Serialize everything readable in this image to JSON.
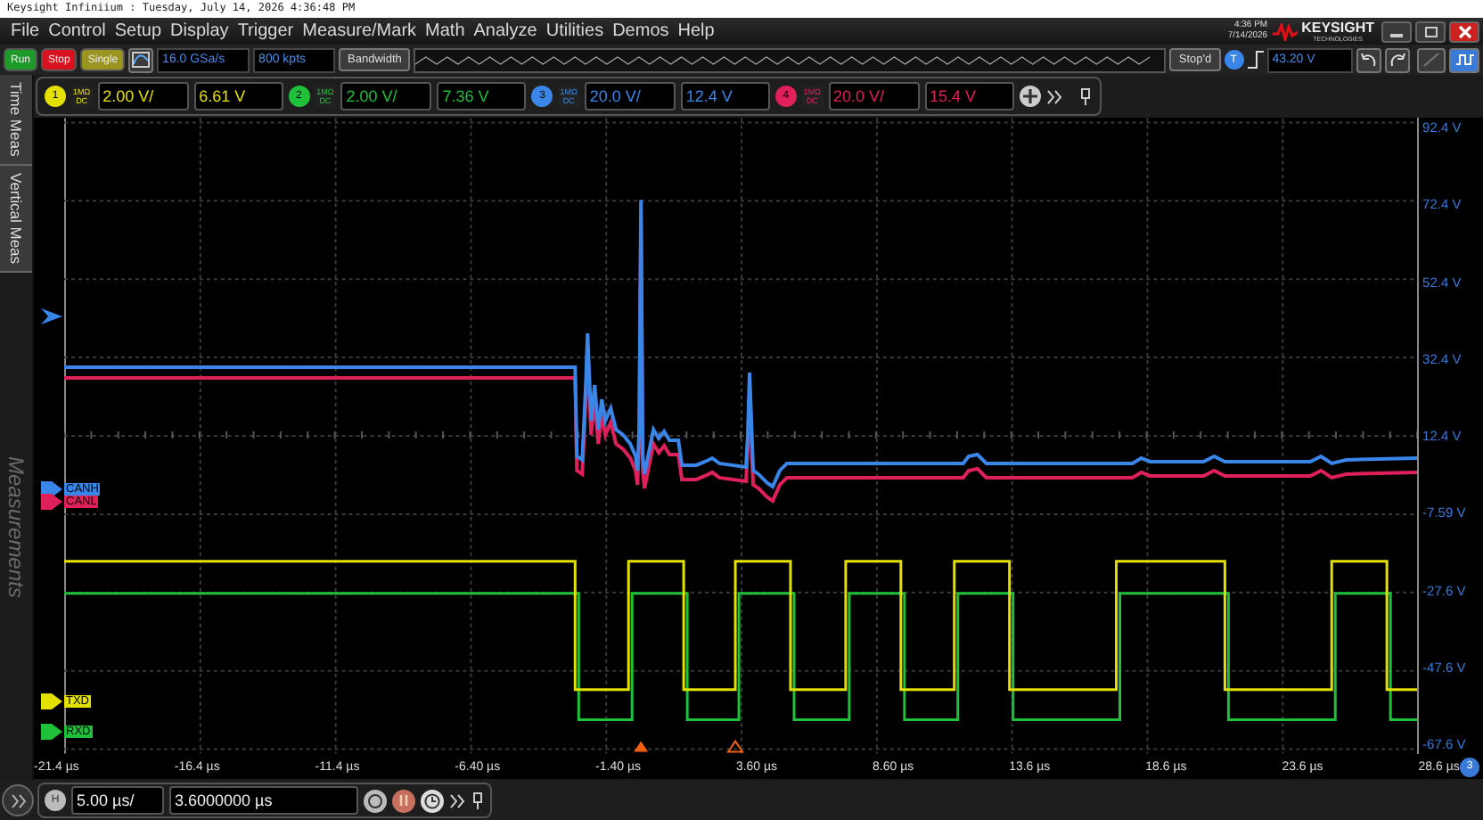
{
  "title_bar": {
    "text": "Keysight Infiniium : Tuesday, July 14, 2026 4:36:48 PM"
  },
  "menu": [
    "File",
    "Control",
    "Setup",
    "Display",
    "Trigger",
    "Measure/Mark",
    "Math",
    "Analyze",
    "Utilities",
    "Demos",
    "Help"
  ],
  "clock": {
    "time": "4:36 PM",
    "date": "7/14/2026"
  },
  "logo": {
    "name": "KEYSIGHT",
    "tagline": "TECHNOLOGIES"
  },
  "run_controls": [
    {
      "label": "Run",
      "color": "#1e9a2a"
    },
    {
      "label": "Stop",
      "color": "#d8121e"
    },
    {
      "label": "Single",
      "color": "#9a9420"
    }
  ],
  "acquisition": {
    "sample_rate": "16.0 GSa/s",
    "memory_depth": "800 kpts",
    "bandwidth_button": "Bandwidth",
    "status": "Stop'd"
  },
  "trigger": {
    "badge": "T",
    "level": "43.20 V"
  },
  "side_tabs": [
    {
      "label": "Time Meas"
    },
    {
      "label": "Vertical Meas"
    }
  ],
  "measurements_panel": {
    "title": "Measurements"
  },
  "channels": [
    {
      "number": "1",
      "impedance": "1MΩ",
      "coupling": "DC",
      "scale": "2.00 V/",
      "offset": "6.61 V",
      "color": "#e4e000"
    },
    {
      "number": "2",
      "impedance": "1MΩ",
      "coupling": "DC",
      "scale": "2.00 V/",
      "offset": "7.36 V",
      "color": "#1fc13a"
    },
    {
      "number": "3",
      "impedance": "1MΩ",
      "coupling": "DC",
      "scale": "20.0 V/",
      "offset": "12.4 V",
      "color": "#3a86e8"
    },
    {
      "number": "4",
      "impedance": "1MΩ",
      "coupling": "DC",
      "scale": "20.0 V/",
      "offset": "15.4 V",
      "color": "#e0205a"
    }
  ],
  "trace_labels": [
    {
      "label": "CANH",
      "color": "#3a86e8"
    },
    {
      "label": "CANL",
      "color": "#e0205a"
    },
    {
      "label": "TXD",
      "color": "#e4e000"
    },
    {
      "label": "RXD",
      "color": "#1fc13a"
    }
  ],
  "y_axis_labels": [
    "92.4 V",
    "72.4 V",
    "52.4 V",
    "32.4 V",
    "12.4 V",
    "-7.59 V",
    "-27.6 V",
    "-47.6 V",
    "-67.6 V"
  ],
  "y_axis_channel": "3",
  "x_axis_labels": [
    "-21.4 µs",
    "-16.4 µs",
    "-11.4 µs",
    "-6.40 µs",
    "-1.40 µs",
    "3.60 µs",
    "8.60 µs",
    "13.6 µs",
    "18.6 µs",
    "23.6 µs",
    "28.6 µs"
  ],
  "horizontal": {
    "badge": "H",
    "scale": "5.00 µs/",
    "position": "3.6000000 µs"
  }
}
